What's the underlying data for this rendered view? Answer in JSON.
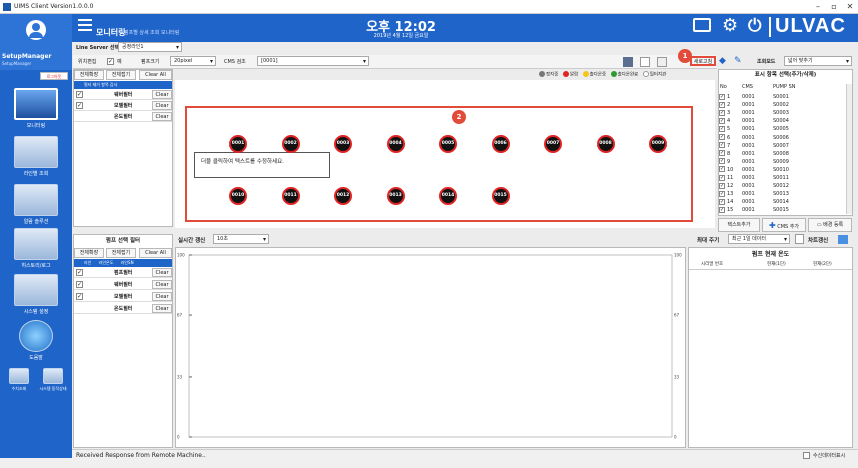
{
  "window": {
    "title": "UIMS Client Version1.0.0.0",
    "min": "–",
    "restore": "▫",
    "close": "✕"
  },
  "header": {
    "app_title": "모니터링",
    "subtitle": "펌프별 상세 조회 모니터링",
    "time": "오후 12:02",
    "date": "2019년 4월 12일 금요일",
    "brand": "ULVAC"
  },
  "user": {
    "name": "SetupManager",
    "role": "SetupManager",
    "logout": "로그아웃"
  },
  "nav": [
    {
      "label": "모니터링"
    },
    {
      "label": "라인별 조회"
    },
    {
      "label": "알람 솔루션"
    },
    {
      "label": "히스토리/로그"
    },
    {
      "label": "시스템 설정"
    },
    {
      "label": "도움말"
    }
  ],
  "nav_small": [
    {
      "label": "수치조회"
    },
    {
      "label": "시스템 동작상태"
    }
  ],
  "line_server": {
    "label": "Line Server 선택",
    "value": "공정라인1"
  },
  "toolbar": {
    "pos_edit": "위치편집",
    "pos_edit_check": "예",
    "pump_size_label": "펌프크기",
    "pump_size": "20pixel",
    "cms_label": "CMS 검조",
    "cms_value": "[0001]",
    "refresh": "새로고침"
  },
  "legend": [
    {
      "label": "정지중",
      "color": "#777777"
    },
    {
      "label": "알람",
      "color": "#e02424"
    },
    {
      "label": "출다운중",
      "color": "#f5c518"
    },
    {
      "label": "출다운완료",
      "color": "#2e9b2e"
    },
    {
      "label": "필터지관",
      "color": "#ffffff"
    }
  ],
  "filter_top": {
    "expand": "전체확장",
    "collapse": "전체접기",
    "clear_all": "Clear All",
    "hint": "필터 제거 항목 감사",
    "items": [
      {
        "label": "웨버필터",
        "clear": "Clear",
        "checked": true
      },
      {
        "label": "모델필터",
        "clear": "Clear",
        "checked": true
      },
      {
        "label": "온도필터",
        "clear": "Clear",
        "checked": false
      }
    ]
  },
  "canvas": {
    "hint_text": "더블 클릭하여 텍스트를 수정하세요.",
    "pumps_row1": [
      "0001",
      "0002",
      "0003",
      "0004",
      "0005",
      "0006",
      "0007",
      "0008",
      "0009"
    ],
    "pumps_row2": [
      "0010",
      "0011",
      "0012",
      "0013",
      "0014",
      "0015"
    ]
  },
  "badges": {
    "one": "1",
    "two": "2"
  },
  "right_panel": {
    "zoom_label": "조회모드",
    "zoom_value": "넓어 맞추기",
    "title": "표시 항목 선택(추가/삭제)",
    "columns": [
      "No",
      "CMS",
      "PUMP SN"
    ],
    "rows": [
      [
        "1",
        "0001",
        "S0001"
      ],
      [
        "2",
        "0001",
        "S0002"
      ],
      [
        "3",
        "0001",
        "S0003"
      ],
      [
        "4",
        "0001",
        "S0004"
      ],
      [
        "5",
        "0001",
        "S0005"
      ],
      [
        "6",
        "0001",
        "S0006"
      ],
      [
        "7",
        "0001",
        "S0007"
      ],
      [
        "8",
        "0001",
        "S0008"
      ],
      [
        "9",
        "0001",
        "S0009"
      ],
      [
        "10",
        "0001",
        "S0010"
      ],
      [
        "11",
        "0001",
        "S0011"
      ],
      [
        "12",
        "0001",
        "S0012"
      ],
      [
        "13",
        "0001",
        "S0013"
      ],
      [
        "14",
        "0001",
        "S0014"
      ],
      [
        "15",
        "0001",
        "S0015"
      ]
    ],
    "add_text": "텍스트추가",
    "add_cms": "CMS 추가",
    "change_bg": "배경 등록"
  },
  "pump_filter": {
    "title": "펌프 선택 필터",
    "expand": "전체확장",
    "collapse": "전체접기",
    "clear_all": "Clear All",
    "chips": [
      "라인",
      "라인온도",
      "라인SN"
    ],
    "items": [
      {
        "label": "펌프필터",
        "clear": "Clear",
        "checked": true
      },
      {
        "label": "웨버필터",
        "clear": "Clear",
        "checked": true
      },
      {
        "label": "모델필터",
        "clear": "Clear",
        "checked": true
      },
      {
        "label": "온도필터",
        "clear": "Clear",
        "checked": false
      }
    ]
  },
  "chart_ctrl": {
    "realtime_label": "실시간 갱신",
    "realtime_value": "10초",
    "period_label": "최대 주기",
    "period_value": "최근 1일 데이터",
    "chart_refresh": "차트갱신"
  },
  "chart_data": {
    "type": "line",
    "series": [],
    "yticks_left": [
      "100",
      "67",
      "33",
      "0"
    ],
    "yticks_right": [
      "100",
      "67",
      "33",
      "0"
    ],
    "ylim": [
      0,
      100
    ]
  },
  "temp_table": {
    "title": "펌프 현재 온도",
    "columns": [
      "시리얼 번호",
      "현재(1단)",
      "현재(2단)"
    ]
  },
  "status": {
    "message": "Received Response from Remote Machine..",
    "checkbox": "수신데이터표시"
  }
}
